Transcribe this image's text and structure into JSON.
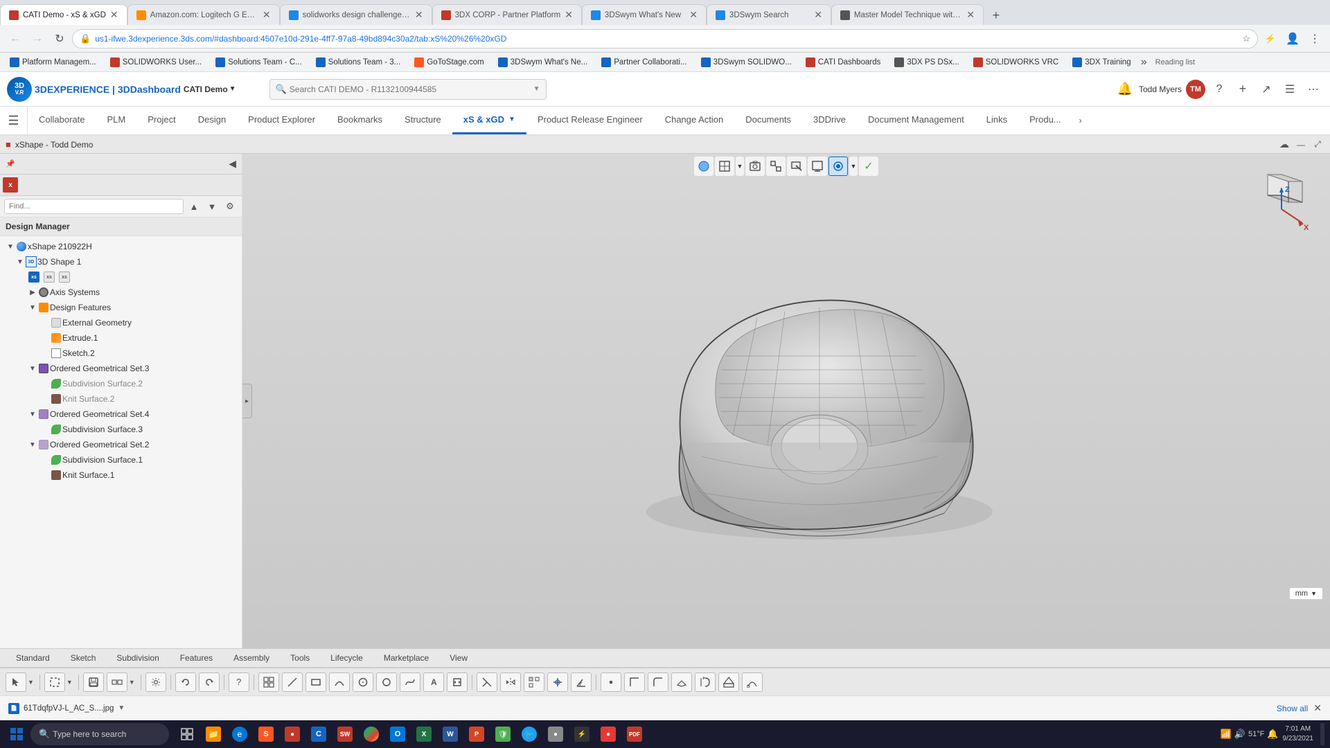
{
  "browser": {
    "tabs": [
      {
        "id": "t1",
        "title": "CATI Demo - xS & xGD",
        "favicon_color": "#c0392b",
        "active": true
      },
      {
        "id": "t2",
        "title": "Amazon.com: Logitech G Extrem...",
        "favicon_color": "#ff8c00",
        "active": false
      },
      {
        "id": "t3",
        "title": "solidworks design challenges - ...",
        "favicon_color": "#1e88e5",
        "active": false
      },
      {
        "id": "t4",
        "title": "3DX CORP - Partner Platform",
        "favicon_color": "#c0392b",
        "active": false
      },
      {
        "id": "t5",
        "title": "3DSwym What's New",
        "favicon_color": "#1e88e5",
        "active": false
      },
      {
        "id": "t6",
        "title": "3DSwym Search",
        "favicon_color": "#1e88e5",
        "active": false
      },
      {
        "id": "t7",
        "title": "Master Model Technique with ...",
        "favicon_color": "#555",
        "active": false
      }
    ],
    "address": "us1-ifwe.3dexperience.3ds.com/#dashboard:4507e10d-291e-4ff7-97a8-49bd894c30a2/tab:xS%20%26%20xGD",
    "bookmarks": [
      "Platform Managem...",
      "SOLIDWORKS User...",
      "Solutions Team - C...",
      "Solutions Team - 3...",
      "GoToStage.com",
      "3DSwym What's Ne...",
      "Partner Collaborati...",
      "3DSwym SOLIDWO...",
      "CATI Dashboards",
      "3DX PS DSx...",
      "SOLIDWORKS VRC",
      "3DX Training"
    ]
  },
  "app_header": {
    "logo_text": "3D",
    "vr_text": "V.R",
    "title": "3DEXPERIENCE | 3DDashboard",
    "demo_name": "CATI Demo",
    "search_placeholder": "Search CATI DEMO - R1132100944585",
    "user_name": "Todd Myers",
    "user_initials": "TM"
  },
  "app_nav": {
    "items": [
      {
        "label": "Collaborate",
        "active": false
      },
      {
        "label": "PLM",
        "active": false
      },
      {
        "label": "Project",
        "active": false
      },
      {
        "label": "Design",
        "active": false
      },
      {
        "label": "Product Explorer",
        "active": false
      },
      {
        "label": "Bookmarks",
        "active": false
      },
      {
        "label": "Structure",
        "active": false
      },
      {
        "label": "xS & xGD",
        "active": true,
        "dropdown": true
      },
      {
        "label": "Product Release Engineer",
        "active": false
      },
      {
        "label": "Change Action",
        "active": false
      },
      {
        "label": "Documents",
        "active": false
      },
      {
        "label": "3DDrive",
        "active": false
      },
      {
        "label": "Document Management",
        "active": false
      },
      {
        "label": "Links",
        "active": false
      },
      {
        "label": "Produ...",
        "active": false
      }
    ]
  },
  "workbench": {
    "title": "xShape - Todd Demo"
  },
  "design_manager": {
    "title": "Design Manager",
    "search_placeholder": "Find...",
    "tree": [
      {
        "id": "root",
        "label": "xShape 210922H",
        "icon": "sphere",
        "level": 0,
        "expanded": true,
        "children": [
          {
            "id": "3dshape1",
            "label": "3D Shape 1",
            "icon": "3dshape",
            "level": 1,
            "expanded": true,
            "children": [
              {
                "id": "xs1",
                "label": "xs",
                "icon": "xs-icon",
                "level": 2,
                "leaf": true
              },
              {
                "id": "xs2",
                "label": "xs",
                "icon": "xs-icon",
                "level": 2,
                "leaf": true
              },
              {
                "id": "xs3",
                "label": "xs",
                "icon": "xs-icon",
                "level": 2,
                "leaf": true
              },
              {
                "id": "axis",
                "label": "Axis Systems",
                "icon": "axis",
                "level": 2,
                "expanded": false,
                "children": []
              },
              {
                "id": "design_features",
                "label": "Design Features",
                "icon": "features",
                "level": 2,
                "expanded": true,
                "children": [
                  {
                    "id": "ext_geom",
                    "label": "External Geometry",
                    "icon": "gray-box",
                    "level": 3,
                    "leaf": true
                  },
                  {
                    "id": "extrude1",
                    "label": "Extrude.1",
                    "icon": "extrude",
                    "level": 3,
                    "leaf": true
                  },
                  {
                    "id": "sketch2",
                    "label": "Sketch.2",
                    "icon": "sketch",
                    "level": 3,
                    "leaf": true
                  }
                ]
              },
              {
                "id": "ogs3",
                "label": "Ordered Geometrical Set.3",
                "icon": "ogs",
                "level": 2,
                "expanded": true,
                "children": [
                  {
                    "id": "subdiv2",
                    "label": "Subdivision Surface.2",
                    "icon": "subdiv",
                    "level": 3,
                    "leaf": true,
                    "grayed": true
                  },
                  {
                    "id": "knit2",
                    "label": "Knit Surface.2",
                    "icon": "knit",
                    "level": 3,
                    "leaf": true,
                    "grayed": true
                  }
                ]
              },
              {
                "id": "ogs4",
                "label": "Ordered Geometrical Set.4",
                "icon": "ogs",
                "level": 2,
                "expanded": true,
                "children": [
                  {
                    "id": "subdiv3",
                    "label": "Subdivision Surface.3",
                    "icon": "subdiv",
                    "level": 3,
                    "leaf": true
                  }
                ]
              },
              {
                "id": "ogs2",
                "label": "Ordered Geometrical Set.2",
                "icon": "ogs",
                "level": 2,
                "expanded": true,
                "children": [
                  {
                    "id": "subdiv1",
                    "label": "Subdivision Surface.1",
                    "icon": "subdiv",
                    "level": 3,
                    "leaf": true
                  },
                  {
                    "id": "knit1",
                    "label": "Knit Surface.1",
                    "icon": "knit",
                    "level": 3,
                    "leaf": true
                  }
                ]
              }
            ]
          }
        ]
      }
    ]
  },
  "viewport_toolbar_buttons": [
    "sphere-icon",
    "view-icon",
    "chevron-down-icon",
    "snapshot-icon",
    "zoom-fit-icon",
    "zoom-area-icon",
    "display-mode-icon",
    "vis-filter-icon",
    "chevron-down-icon",
    "check-icon"
  ],
  "unit": "mm",
  "bottom_tabs": [
    {
      "label": "Standard",
      "active": false
    },
    {
      "label": "Sketch",
      "active": false
    },
    {
      "label": "Subdivision",
      "active": false
    },
    {
      "label": "Features",
      "active": false
    },
    {
      "label": "Assembly",
      "active": false
    },
    {
      "label": "Tools",
      "active": false
    },
    {
      "label": "Lifecycle",
      "active": false
    },
    {
      "label": "Marketplace",
      "active": false
    },
    {
      "label": "View",
      "active": false
    }
  ],
  "status_bar": {
    "filename": "61TdqfpVJ-L_AC_S....jpg",
    "show_all_label": "Show all"
  },
  "taskbar": {
    "search_placeholder": "Type here to search",
    "time": "7:01 AM",
    "date": "9/23/2021",
    "temperature": "51°F"
  }
}
